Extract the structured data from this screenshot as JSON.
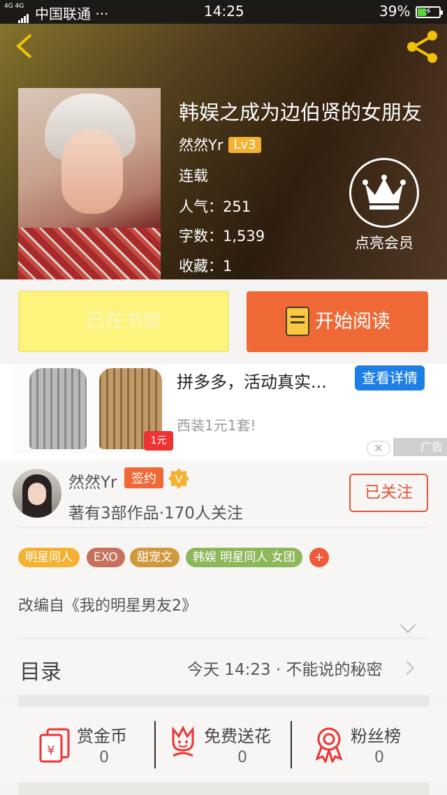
{
  "status_bar": {
    "network": "4G 4G",
    "carrier": "中国联通 ···",
    "time": "14:25",
    "battery": "39%",
    "battery_level": 0.39,
    "battery_color": "#5ad23a"
  },
  "header": {
    "back_icon": "chevron-left-icon",
    "share_icon": "share-icon",
    "accent": "#f2c200"
  },
  "book": {
    "title": "韩娱之成为边伯贤的女朋友",
    "author": "然然Yr",
    "level": "Lv3",
    "status": "连载",
    "popularity": "人气：251",
    "word_count": "字数：1,539",
    "favorites": "收藏：1"
  },
  "vip": {
    "label": "点亮会员",
    "icon": "crown-icon"
  },
  "actions": {
    "shelf_label": "已在书架",
    "read_label": "开始阅读",
    "read_color": "#ee6936",
    "shelf_color": "#fdf47d"
  },
  "ad": {
    "headline": "拼多多，活动真实...",
    "detail_button": "查看详情",
    "subtitle": "西装1元1套!",
    "label": "广告",
    "promo": "1元 抢!"
  },
  "author_section": {
    "name": "然然Yr",
    "badge": "签约",
    "verified": "V",
    "works": "著有3部作品·170人关注",
    "follow_button": "已关注"
  },
  "tags": [
    {
      "label": "明星同人",
      "color": "#f5b131"
    },
    {
      "label": "EXO",
      "color": "#c7705c"
    },
    {
      "label": "甜宠文",
      "color": "#cf9a3e"
    },
    {
      "label": "韩娱 明星同人 女团",
      "color": "#8eb65b"
    }
  ],
  "add_tag": "+",
  "description": "改编自《我的明星男友2》",
  "toc": {
    "label": "目录",
    "latest": "今天 14:23 · 不能说的秘密"
  },
  "stats": [
    {
      "label": "赏金币",
      "value": "0",
      "icon": "red-envelope-icon"
    },
    {
      "label": "免费送花",
      "value": "0",
      "icon": "flower-icon"
    },
    {
      "label": "粉丝榜",
      "value": "0",
      "icon": "medal-icon"
    }
  ]
}
